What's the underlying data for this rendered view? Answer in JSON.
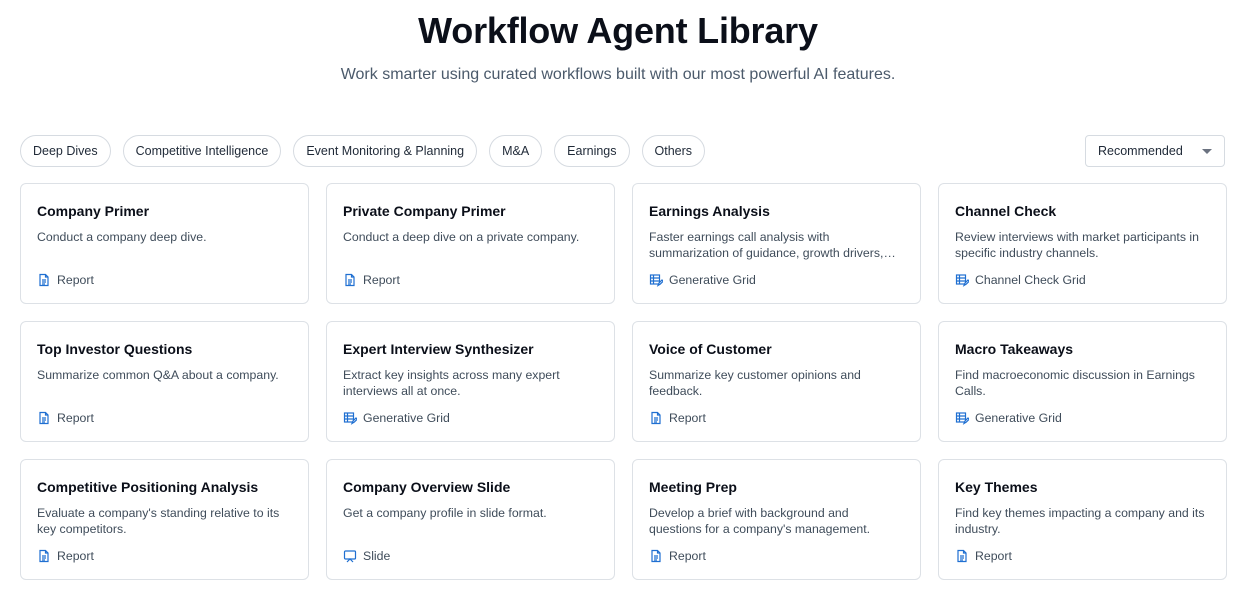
{
  "header": {
    "title": "Workflow Agent Library",
    "subtitle": "Work smarter using curated workflows built with our most powerful AI features."
  },
  "filters": [
    {
      "id": "deep-dives",
      "label": "Deep Dives"
    },
    {
      "id": "competitive-intelligence",
      "label": "Competitive Intelligence"
    },
    {
      "id": "event-monitoring-planning",
      "label": "Event Monitoring & Planning"
    },
    {
      "id": "ma",
      "label": "M&A"
    },
    {
      "id": "earnings",
      "label": "Earnings"
    },
    {
      "id": "others",
      "label": "Others"
    }
  ],
  "sort": {
    "selected": "Recommended"
  },
  "cards": [
    {
      "slug": "company-primer",
      "title": "Company Primer",
      "description": "Conduct a company deep dive.",
      "type": "Report",
      "icon": "report-icon"
    },
    {
      "slug": "private-company-primer",
      "title": "Private Company Primer",
      "description": "Conduct a deep dive on a private company.",
      "type": "Report",
      "icon": "report-icon"
    },
    {
      "slug": "earnings-analysis",
      "title": "Earnings Analysis",
      "description": "Faster earnings call analysis with summarization of guidance, growth drivers, risks and more.",
      "type": "Generative Grid",
      "icon": "grid-icon"
    },
    {
      "slug": "channel-check",
      "title": "Channel Check",
      "description": "Review interviews with market participants in specific industry channels.",
      "type": "Channel Check Grid",
      "icon": "grid-icon"
    },
    {
      "slug": "top-investor-questions",
      "title": "Top Investor Questions",
      "description": "Summarize common Q&A about a company.",
      "type": "Report",
      "icon": "report-icon"
    },
    {
      "slug": "expert-interview-synthesizer",
      "title": "Expert Interview Synthesizer",
      "description": "Extract key insights across many expert interviews all at once.",
      "type": "Generative Grid",
      "icon": "grid-icon"
    },
    {
      "slug": "voice-of-customer",
      "title": "Voice of Customer",
      "description": "Summarize key customer opinions and feedback.",
      "type": "Report",
      "icon": "report-icon"
    },
    {
      "slug": "macro-takeaways",
      "title": "Macro Takeaways",
      "description": "Find macroeconomic discussion in Earnings Calls.",
      "type": "Generative Grid",
      "icon": "grid-icon"
    },
    {
      "slug": "competitive-positioning-analysis",
      "title": "Competitive Positioning Analysis",
      "description": "Evaluate a company's standing relative to its key competitors.",
      "type": "Report",
      "icon": "report-icon"
    },
    {
      "slug": "company-overview-slide",
      "title": "Company Overview Slide",
      "description": "Get a company profile in slide format.",
      "type": "Slide",
      "icon": "slide-icon"
    },
    {
      "slug": "meeting-prep",
      "title": "Meeting Prep",
      "description": "Develop a brief with background and questions for a company's management.",
      "type": "Report",
      "icon": "report-icon"
    },
    {
      "slug": "key-themes",
      "title": "Key Themes",
      "description": "Find key themes impacting a company and its industry.",
      "type": "Report",
      "icon": "report-icon"
    }
  ],
  "colors": {
    "accent": "#1f6fd1",
    "border": "#dde1e6",
    "text_muted": "#3f4c5a"
  }
}
